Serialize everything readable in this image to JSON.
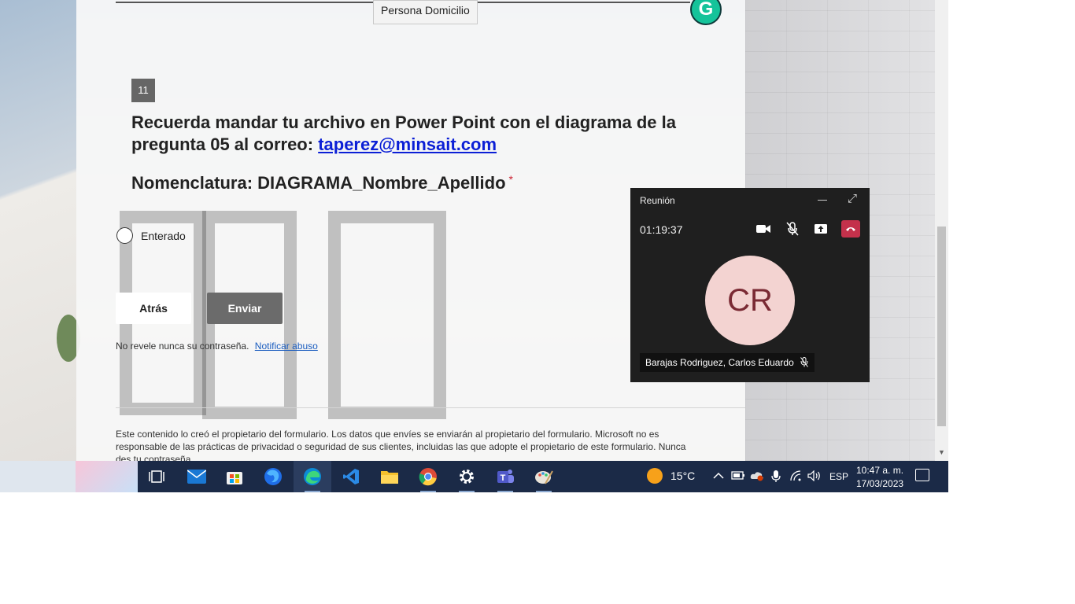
{
  "form": {
    "tooltip": "Persona Domicilio",
    "grammarly_letter": "G",
    "question_number": "11",
    "question_text": "Recuerda mandar tu archivo en Power Point con el diagrama de la pregunta 05 al correo: ",
    "question_email": "taperez@minsait.com",
    "nomenclature": "Nomenclatura: DIAGRAMA_Nombre_Apellido",
    "required_mark": "*",
    "option_label": "Enterado",
    "back_button": "Atrás",
    "submit_button": "Enviar",
    "password_warning": "No revele nunca su contraseña.",
    "report_abuse": "Notificar abuso",
    "footer_text": "Este contenido lo creó el propietario del formulario. Los datos que envíes se enviarán al propietario del formulario. Microsoft no es responsable de las prácticas de privacidad o seguridad de sus clientes, incluidas las que adopte el propietario de este formulario. Nunca des tu contraseña."
  },
  "meeting": {
    "title": "Reunión",
    "timer": "01:19:37",
    "avatar_initials": "CR",
    "participant_name": "Barajas Rodriguez, Carlos Eduardo"
  },
  "taskbar": {
    "apps": [
      "task-view",
      "mail",
      "store",
      "firefox",
      "edge",
      "vscode",
      "file-explorer",
      "chrome",
      "settings",
      "teams",
      "paint"
    ],
    "weather_temp": "15°C",
    "language": "ESP",
    "time": "10:47 a. m.",
    "date": "17/03/2023"
  },
  "colors": {
    "accent_link": "#0b1fd6",
    "hangup": "#c4314b",
    "avatar_bg": "#f3d3d1",
    "taskbar": "#1b2a47"
  }
}
